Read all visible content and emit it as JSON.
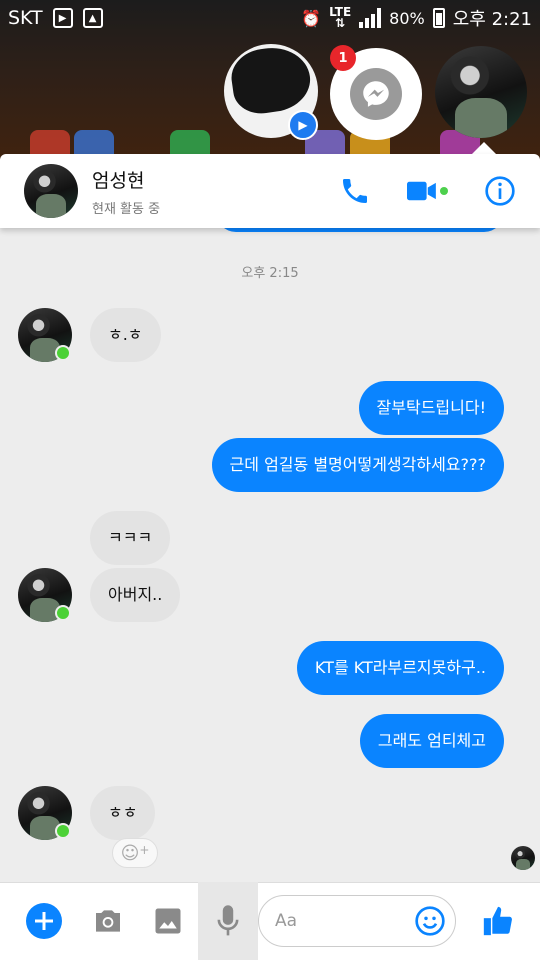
{
  "status_bar": {
    "carrier": "SKT",
    "network": "LTE",
    "battery": "80%",
    "time": "오후 2:21"
  },
  "chat_heads": {
    "unread_badge": "1"
  },
  "header": {
    "contact_name": "엄성현",
    "activity_status": "현재 활동 중"
  },
  "conversation": {
    "timestamp": "오후 2:15",
    "messages": [
      {
        "from": "them",
        "text": "ㅎ.ㅎ"
      },
      {
        "from": "me",
        "text": "잘부탁드립니다!"
      },
      {
        "from": "me",
        "text": "근데 엄길동 별명어떻게생각하세요???"
      },
      {
        "from": "them",
        "text": "ㅋㅋㅋ"
      },
      {
        "from": "them",
        "text": "아버지.."
      },
      {
        "from": "me",
        "text": "KT를 KT라부르지못하구.."
      },
      {
        "from": "me",
        "text": "그래도 엄티체고"
      },
      {
        "from": "them",
        "text": "ㅎㅎ"
      }
    ]
  },
  "composer": {
    "placeholder": "Aa"
  },
  "colors": {
    "accent": "#0a84ff",
    "incoming_bubble": "#e3e3e3",
    "online": "#4cd137",
    "badge": "#e8262b"
  },
  "icons": {
    "header": [
      "phone-icon",
      "video-camera-icon",
      "info-icon"
    ],
    "composer": [
      "plus-icon",
      "camera-icon",
      "image-icon",
      "microphone-icon",
      "emoji-icon",
      "thumbs-up-icon"
    ]
  }
}
